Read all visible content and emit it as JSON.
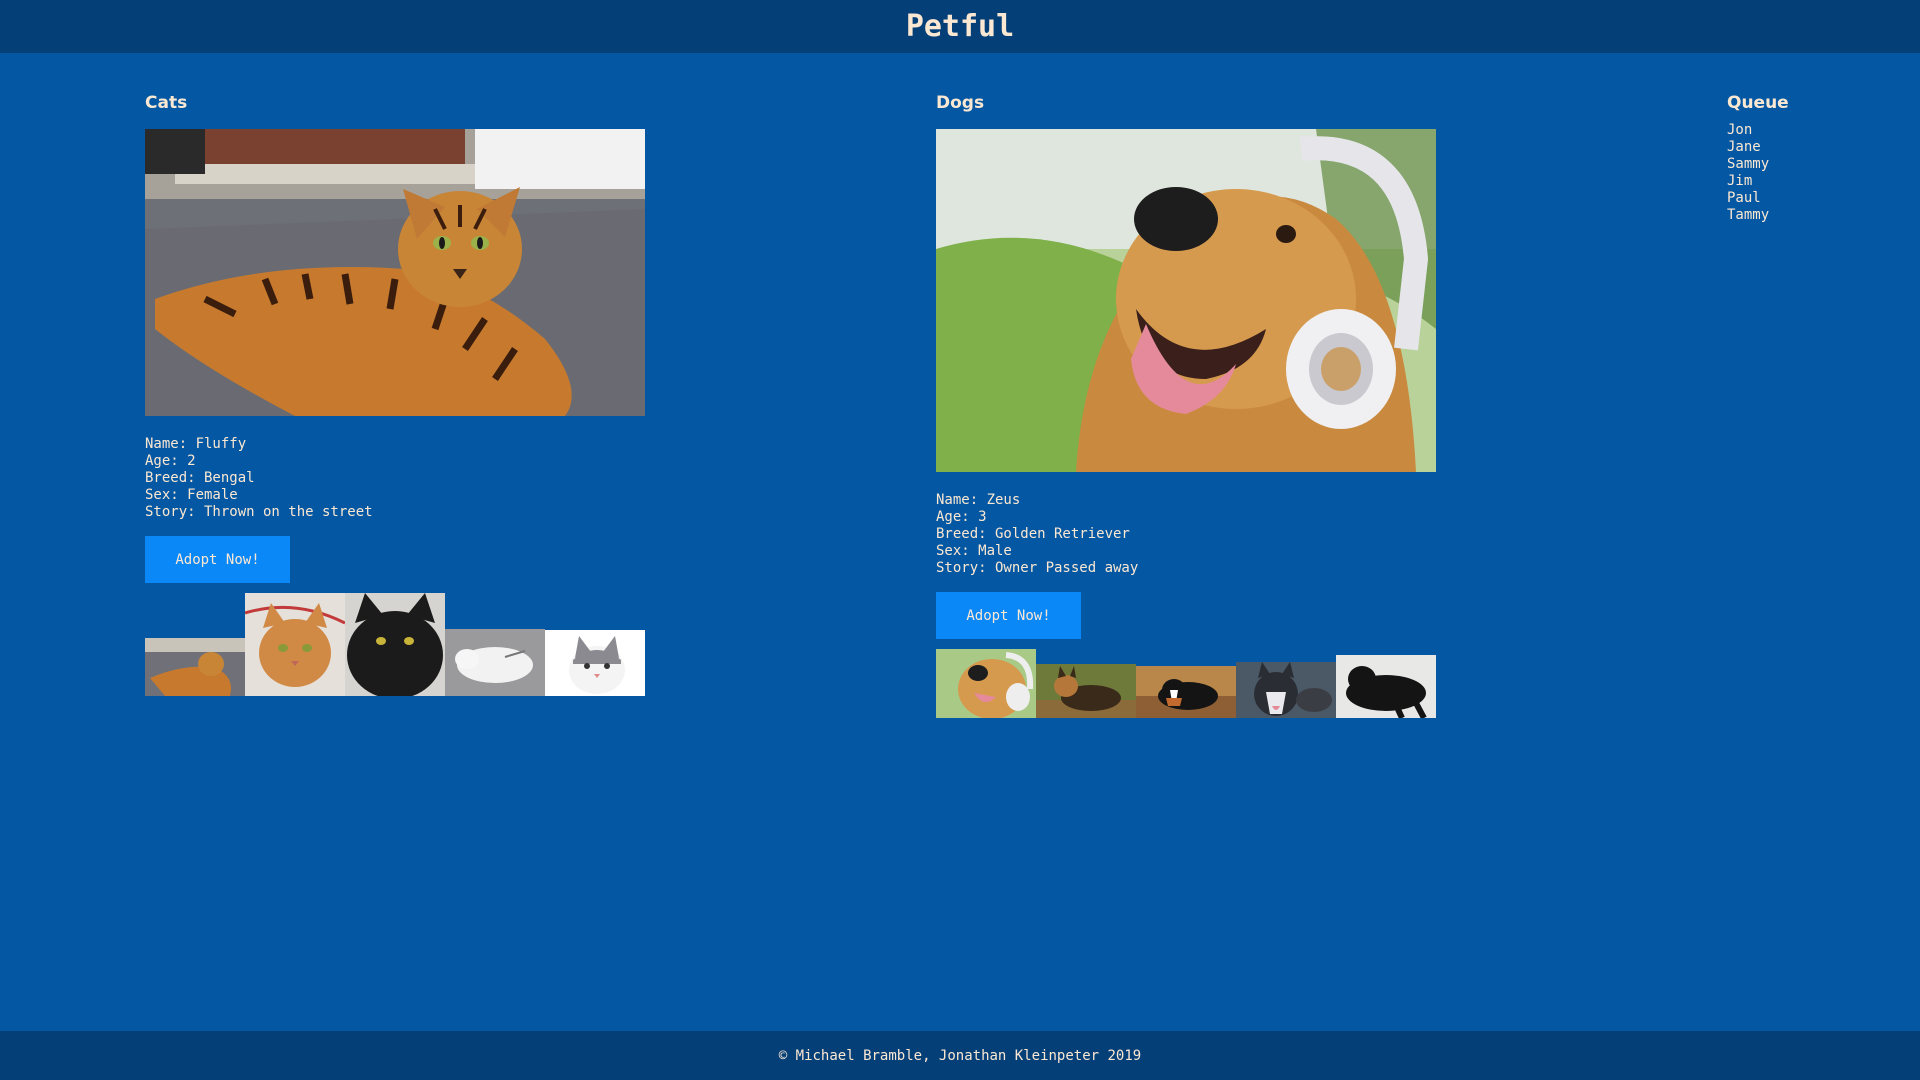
{
  "header": {
    "title": "Petful"
  },
  "cats": {
    "heading": "Cats",
    "details": {
      "name": "Name: Fluffy",
      "age": "Age: 2",
      "breed": "Breed: Bengal",
      "sex": "Sex: Female",
      "story": "Story: Thrown on the street"
    },
    "adopt_label": "Adopt Now!",
    "thumbnails": [
      "bengal-cat",
      "orange-tabby-cat",
      "black-cat",
      "white-cat-sleeping",
      "grey-white-kitten"
    ]
  },
  "dogs": {
    "heading": "Dogs",
    "details": {
      "name": "Name: Zeus",
      "age": "Age: 3",
      "breed": "Breed: Golden Retriever",
      "sex": "Sex: Male",
      "story": "Story: Owner Passed away"
    },
    "adopt_label": "Adopt Now!",
    "thumbnails": [
      "golden-retriever-headphones",
      "german-shepherd",
      "bernese-mountain-dog",
      "husky",
      "black-labrador"
    ]
  },
  "queue": {
    "heading": "Queue",
    "people": [
      "Jon",
      "Jane",
      "Sammy",
      "Jim",
      "Paul",
      "Tammy"
    ]
  },
  "footer": {
    "text": "© Michael Bramble, Jonathan Kleinpeter 2019"
  },
  "colors": {
    "background": "#0457a2",
    "bar": "#053f78",
    "button": "#0a88f8",
    "text": "#fbe8d3"
  }
}
